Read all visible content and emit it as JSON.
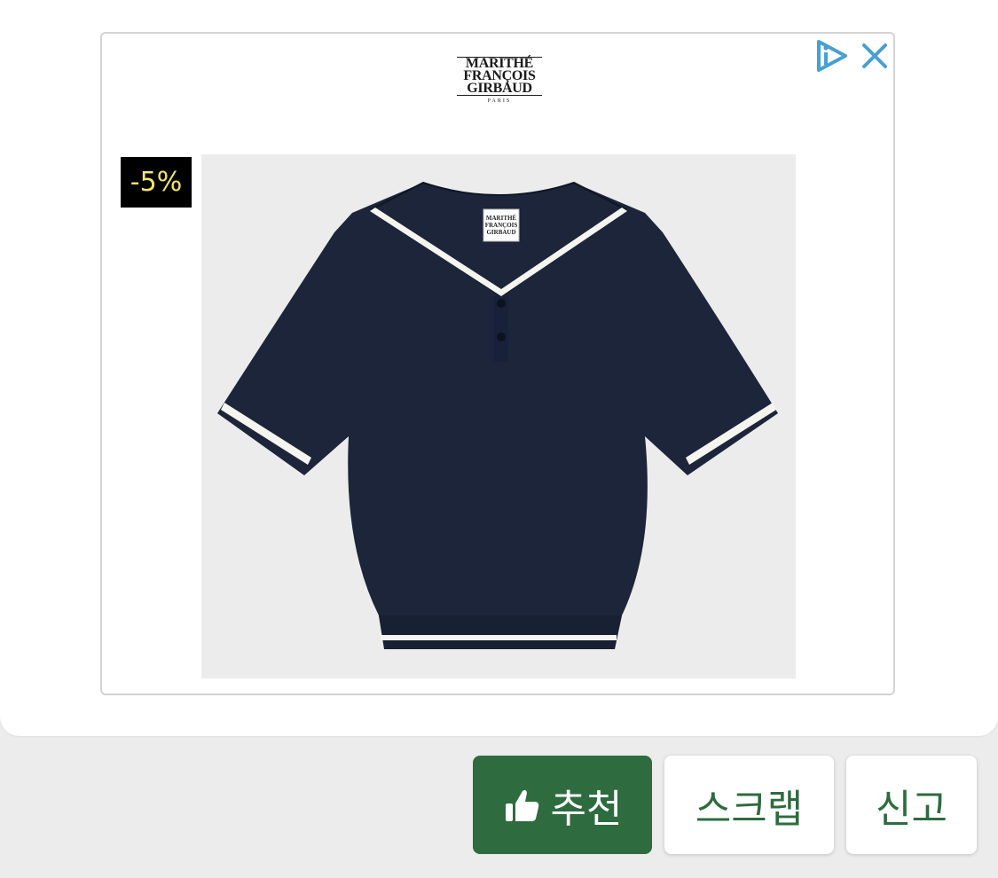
{
  "ad": {
    "brand_lines": [
      "MARITHÉ",
      "FRANÇOIS",
      "GIRBAUD"
    ],
    "brand_sub": "PARIS",
    "discount": "-5%",
    "product_tag_lines": [
      "MARITHÉ",
      "FRANÇOIS",
      "GIRBAUD"
    ],
    "icons": {
      "ad_choices": "adchoices-icon",
      "close": "close-icon"
    },
    "colors": {
      "icon": "#4a9fcf",
      "badge_bg": "#000000",
      "badge_text": "#f2e66b",
      "shirt": "#1c2539",
      "trim": "#f5f5f0"
    }
  },
  "actions": {
    "recommend_label": "추천",
    "scrap_label": "스크랩",
    "report_label": "신고",
    "colors": {
      "primary": "#2e6b3f"
    }
  }
}
